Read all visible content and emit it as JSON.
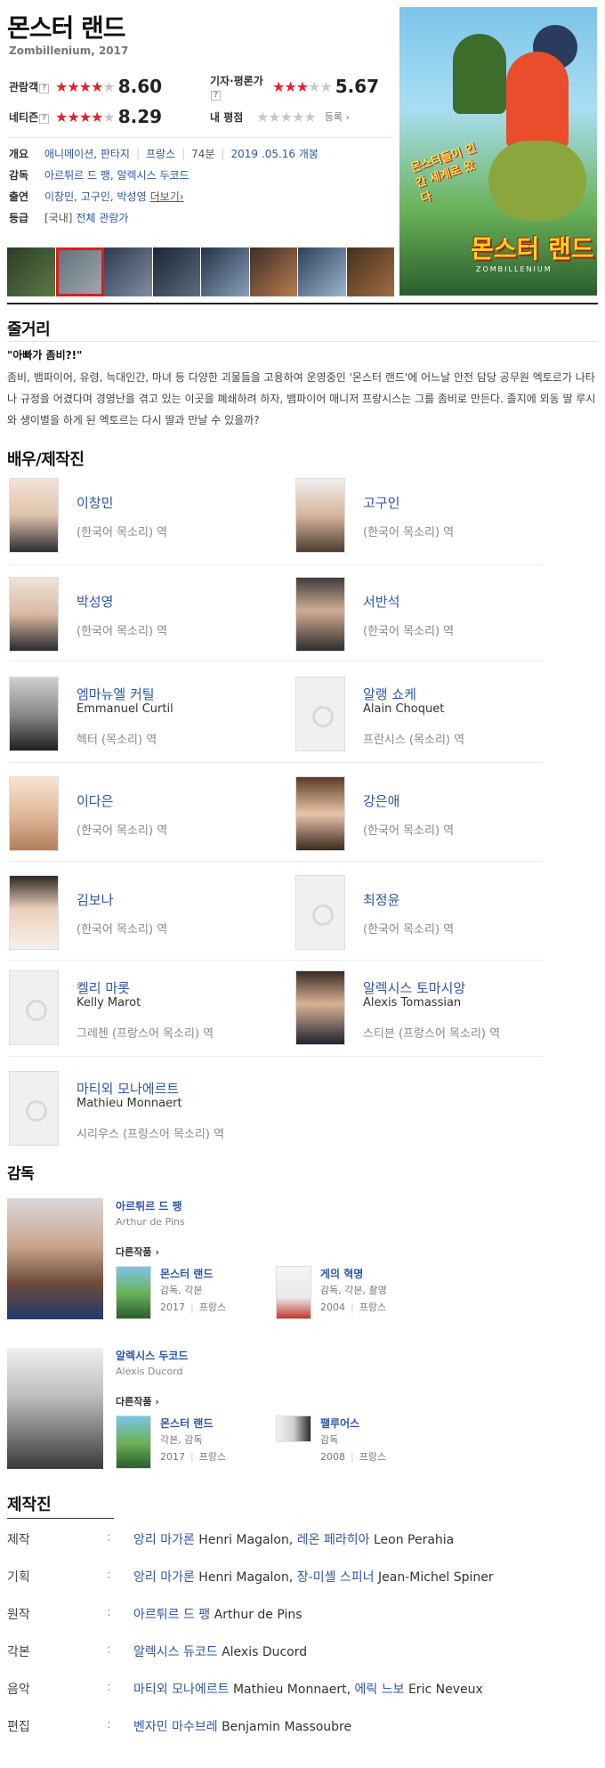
{
  "movie": {
    "title": "몬스터 랜드",
    "subtitle": "Zombillenium, 2017",
    "ratings": {
      "audience_label": "관람객",
      "audience_score": "8.60",
      "audience_stars": 4,
      "critic_label": "기자·평론가",
      "critic_score": "5.67",
      "critic_stars": 3,
      "netizen_label": "네티즌",
      "netizen_score": "8.29",
      "netizen_stars": 4,
      "my_label": "내 평점",
      "register_label": "등록"
    },
    "info": {
      "overview_label": "개요",
      "genre": "애니메이션, 판타지",
      "country": "프랑스",
      "runtime": "74분",
      "release": "2019 .05.16 개봉",
      "director_label": "감독",
      "directors": "아르튀르 드 팽, 알렉시스 두코드",
      "cast_label": "출연",
      "cast": "이창민, 고구인, 박성영",
      "more": "더보기",
      "grade_label": "등급",
      "grade_country": "[국내]",
      "grade": "전체 관람가"
    },
    "poster": {
      "title": "몬스터 랜드",
      "sub": "ZOMBILLENIUM",
      "band": "몬스터들이 인간 세계로 왔다"
    }
  },
  "plot": {
    "section_title": "줄거리",
    "headline": "\"아빠가 좀비?!\"",
    "text": "좀비, 뱀파이어, 유령, 늑대인간, 마녀 등 다양한 괴물들을 고용하여 운영중인 '몬스터 랜드'에 어느날 안전 담당 공무원 엑토르가 나타나 규정을 어겼다며 경영난을 겪고 있는 이곳을 폐쇄하려 하자, 뱀파이어 매니저 프랑시스는 그를 좀비로 만든다. 졸지에 외동 딸 루시와 생이별을 하게 된 엑토르는 다시 딸과 만날 수 있을까?"
  },
  "cast_section_title": "배우/제작진",
  "cast_members": [
    {
      "name": "이창민",
      "en": "",
      "role": "(한국어 목소리) 역"
    },
    {
      "name": "고구인",
      "en": "",
      "role": "(한국어 목소리) 역"
    },
    {
      "name": "박성영",
      "en": "",
      "role": "(한국어 목소리) 역"
    },
    {
      "name": "서반석",
      "en": "",
      "role": "(한국어 목소리) 역"
    },
    {
      "name": "엠마뉴엘 커틸",
      "en": "Emmanuel Curtil",
      "role": "헥터 (목소리) 역"
    },
    {
      "name": "알랭 쇼케",
      "en": "Alain Choquet",
      "role": "프란시스 (목소리) 역"
    },
    {
      "name": "이다은",
      "en": "",
      "role": "(한국어 목소리) 역"
    },
    {
      "name": "강은애",
      "en": "",
      "role": "(한국어 목소리) 역"
    },
    {
      "name": "김보나",
      "en": "",
      "role": "(한국어 목소리) 역"
    },
    {
      "name": "최정윤",
      "en": "",
      "role": "(한국어 목소리) 역"
    },
    {
      "name": "켈리 마롯",
      "en": "Kelly Marot",
      "role": "그레첸 (프랑스어 목소리) 역"
    },
    {
      "name": "알렉시스 토마시앙",
      "en": "Alexis Tomassian",
      "role": "스티븐 (프랑스어 목소리) 역"
    },
    {
      "name": "마티외 모나에르트",
      "en": "Mathieu Monnaert",
      "role": "시리우스 (프랑스어 목소리) 역"
    }
  ],
  "directors_section_title": "감독",
  "directors": [
    {
      "name": "아르튀르 드 팽",
      "en": "Arthur de Pins",
      "other_label": "다른작품",
      "films": [
        {
          "title": "몬스터 랜드",
          "role": "감독, 각본",
          "year": "2017",
          "country": "프랑스"
        },
        {
          "title": "게의 혁명",
          "role": "감독, 각본, 촬영",
          "year": "2004",
          "country": "프랑스"
        }
      ]
    },
    {
      "name": "알렉시스 두코드",
      "en": "Alexis Ducord",
      "other_label": "다른작품",
      "films": [
        {
          "title": "몬스터 랜드",
          "role": "각본, 감독",
          "year": "2017",
          "country": "프랑스"
        },
        {
          "title": "팰루어스",
          "role": "감독",
          "year": "2008",
          "country": "프랑스"
        }
      ]
    }
  ],
  "crew": {
    "section_title": "제작진",
    "rows": [
      {
        "label": "제작",
        "colon": ":",
        "p1": "앙리 마가론",
        "e1": " Henri Magalon, ",
        "p2": "레온 페라히아",
        "e2": " Leon Perahia"
      },
      {
        "label": "기획",
        "colon": ":",
        "p1": "앙리 마가론",
        "e1": " Henri Magalon, ",
        "p2": "장-미셸 스피너",
        "e2": " Jean-Michel Spiner"
      },
      {
        "label": "원작",
        "colon": ":",
        "p1": "아르튀르 드 팽",
        "e1": " Arthur de Pins",
        "p2": "",
        "e2": ""
      },
      {
        "label": "각본",
        "colon": ":",
        "p1": "알렉시스 듀코드",
        "e1": " Alexis Ducord",
        "p2": "",
        "e2": ""
      },
      {
        "label": "음악",
        "colon": ":",
        "p1": "마티외 모나에르트",
        "e1": " Mathieu Monnaert, ",
        "p2": "에릭 느보",
        "e2": " Eric Neveux"
      },
      {
        "label": "편집",
        "colon": ":",
        "p1": "벤자민 마수브레",
        "e1": " Benjamin Massoubre",
        "p2": "",
        "e2": ""
      }
    ]
  }
}
